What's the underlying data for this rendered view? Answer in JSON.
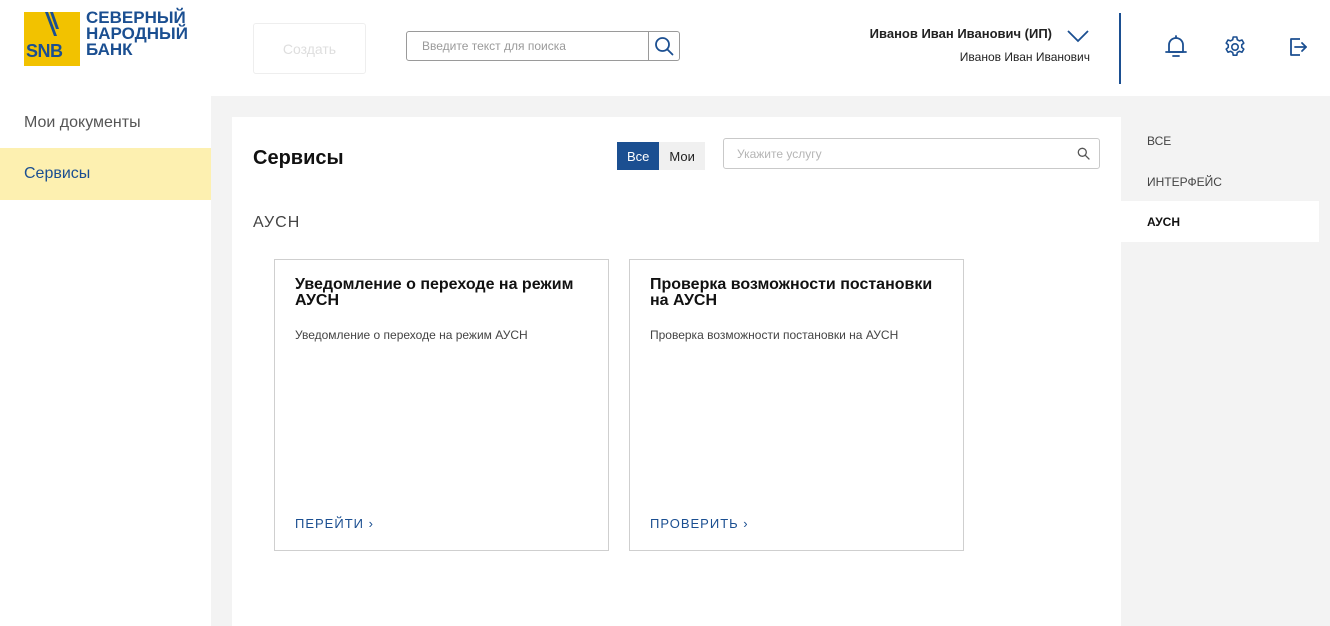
{
  "brand": {
    "logo_abbr": "SNB",
    "logo_lines": [
      "СЕВЕРНЫЙ",
      "НАРОДНЫЙ",
      "БАНК"
    ]
  },
  "header": {
    "create_label": "Создать",
    "search_placeholder": "Введите текст для поиска",
    "user_name": "Иванов Иван Иванович (ИП)",
    "user_sub": "Иванов Иван Иванович",
    "icons": [
      "bell-icon",
      "gear-icon",
      "logout-icon"
    ]
  },
  "leftnav": {
    "items": [
      {
        "label": "Мои документы",
        "active": false
      },
      {
        "label": "Сервисы",
        "active": true
      }
    ]
  },
  "main": {
    "title": "Сервисы",
    "filter": {
      "all_label": "Все",
      "mine_label": "Мои",
      "selected": "Все"
    },
    "search_placeholder": "Укажите услугу",
    "section_label": "АУСН",
    "cards": [
      {
        "title": "Уведомление о переходе на режим АУСН",
        "description": "Уведомление о переходе на режим АУСН",
        "action": "ПЕРЕЙТИ ›"
      },
      {
        "title": "Проверка возможности постановки на АУСН",
        "description": "Проверка возможности постановки на АУСН",
        "action": "ПРОВЕРИТЬ ›"
      }
    ]
  },
  "rightnav": {
    "items": [
      {
        "label": "ВСЕ",
        "active": false
      },
      {
        "label": "ИНТЕРФЕЙС",
        "active": false
      },
      {
        "label": "АУСН",
        "active": true
      }
    ]
  },
  "colors": {
    "accent": "#1b4f91",
    "brand_yellow": "#f2c200",
    "active_nav_bg": "#fdf0b0",
    "page_bg": "#f3f3f3"
  }
}
